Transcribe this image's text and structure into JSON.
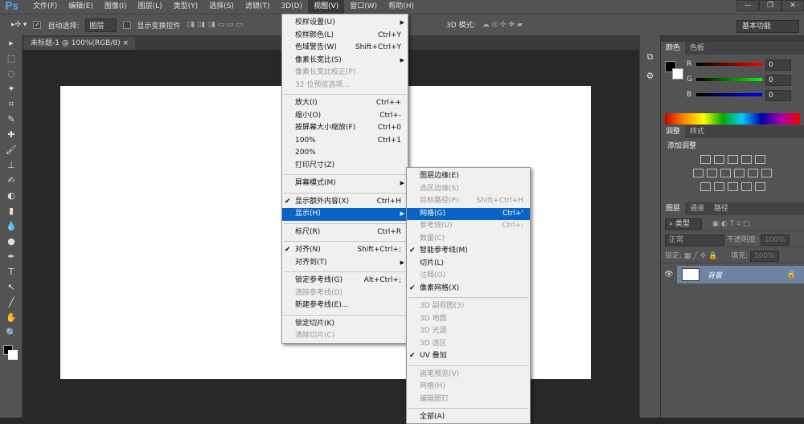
{
  "app": {
    "logo": "Ps"
  },
  "menubar": [
    "文件(F)",
    "编辑(E)",
    "图像(I)",
    "图层(L)",
    "类型(Y)",
    "选择(S)",
    "滤镜(T)",
    "3D(D)",
    "视图(V)",
    "窗口(W)",
    "帮助(H)"
  ],
  "window_controls": [
    "—",
    "❐",
    "✕"
  ],
  "options": {
    "auto_select_label": "自动选择:",
    "auto_select_value": "图层",
    "show_transform_label": "显示变换控件",
    "mode_3d_label": "3D 模式:",
    "workspace": "基本功能"
  },
  "document_tab": {
    "title": "未标题-1 @ 100%(RGB/8)",
    "close": "×"
  },
  "view_menu": [
    {
      "label": "校样设置(U)",
      "submenu": true
    },
    {
      "label": "校样颜色(L)",
      "shortcut": "Ctrl+Y"
    },
    {
      "label": "色域警告(W)",
      "shortcut": "Shift+Ctrl+Y"
    },
    {
      "label": "像素长宽比(S)",
      "submenu": true
    },
    {
      "label": "像素长宽比校正(P)",
      "disabled": true
    },
    {
      "label": "32 位预览选项...",
      "disabled": true
    },
    {
      "sep": true
    },
    {
      "label": "放大(I)",
      "shortcut": "Ctrl++"
    },
    {
      "label": "缩小(O)",
      "shortcut": "Ctrl+-"
    },
    {
      "label": "按屏幕大小缩放(F)",
      "shortcut": "Ctrl+0"
    },
    {
      "label": "100%",
      "shortcut": "Ctrl+1"
    },
    {
      "label": "200%"
    },
    {
      "label": "打印尺寸(Z)"
    },
    {
      "sep": true
    },
    {
      "label": "屏幕模式(M)",
      "submenu": true
    },
    {
      "sep": true
    },
    {
      "label": "显示额外内容(X)",
      "shortcut": "Ctrl+H",
      "checked": true
    },
    {
      "label": "显示(H)",
      "submenu": true,
      "highlighted": true
    },
    {
      "sep": true
    },
    {
      "label": "标尺(R)",
      "shortcut": "Ctrl+R"
    },
    {
      "sep": true
    },
    {
      "label": "对齐(N)",
      "shortcut": "Shift+Ctrl+;",
      "checked": true
    },
    {
      "label": "对齐到(T)",
      "submenu": true
    },
    {
      "sep": true
    },
    {
      "label": "锁定参考线(G)",
      "shortcut": "Alt+Ctrl+;"
    },
    {
      "label": "清除参考线(D)",
      "disabled": true
    },
    {
      "label": "新建参考线(E)..."
    },
    {
      "sep": true
    },
    {
      "label": "锁定切片(K)"
    },
    {
      "label": "清除切片(C)",
      "disabled": true
    }
  ],
  "show_submenu": [
    {
      "label": "图层边缘(E)"
    },
    {
      "label": "选区边缘(S)",
      "disabled": true
    },
    {
      "label": "目标路径(P)",
      "shortcut": "Shift+Ctrl+H",
      "disabled": true
    },
    {
      "label": "网格(G)",
      "shortcut": "Ctrl+'",
      "highlighted": true
    },
    {
      "label": "参考线(U)",
      "shortcut": "Ctrl+;",
      "disabled": true
    },
    {
      "label": "数量(C)",
      "disabled": true
    },
    {
      "label": "智能参考线(M)",
      "checked": true
    },
    {
      "label": "切片(L)"
    },
    {
      "label": "注释(O)",
      "disabled": true
    },
    {
      "label": "像素网格(X)",
      "checked": true
    },
    {
      "sep": true
    },
    {
      "label": "3D 副视图(3)",
      "disabled": true
    },
    {
      "label": "3D 地面",
      "disabled": true
    },
    {
      "label": "3D 光源",
      "disabled": true
    },
    {
      "label": "3D 选区",
      "disabled": true
    },
    {
      "label": "UV 叠加",
      "checked": true
    },
    {
      "sep": true
    },
    {
      "label": "画笔预览(V)",
      "disabled": true
    },
    {
      "label": "网格(H)",
      "disabled": true
    },
    {
      "label": "编辑图钉",
      "disabled": true
    },
    {
      "sep": true
    },
    {
      "label": "全部(A)"
    }
  ],
  "color_panel": {
    "tabs": [
      "颜色",
      "色板"
    ],
    "channels": [
      {
        "name": "R",
        "value": "0",
        "color": "#ff0000"
      },
      {
        "name": "G",
        "value": "0",
        "color": "#00ff00"
      },
      {
        "name": "B",
        "value": "0",
        "color": "#0000ff"
      }
    ]
  },
  "adjust_panel": {
    "tabs": [
      "调整",
      "样式"
    ],
    "title": "添加调整"
  },
  "layers_panel": {
    "tabs": [
      "图层",
      "通道",
      "路径"
    ],
    "filter": "类型",
    "blend": "正常",
    "opacity_label": "不透明度:",
    "opacity": "100%",
    "lock_label": "锁定:",
    "fill_label": "填充:",
    "fill": "100%",
    "layer_name": "背景"
  },
  "tools": [
    "▸",
    "⬚",
    "◌",
    "✦",
    "⌗",
    "✎",
    "✚",
    "🖌",
    "⊥",
    "✍",
    "◐",
    "▮",
    "💧",
    "●",
    "✒",
    "T",
    "↖",
    "╱",
    "✋",
    "🔍"
  ]
}
